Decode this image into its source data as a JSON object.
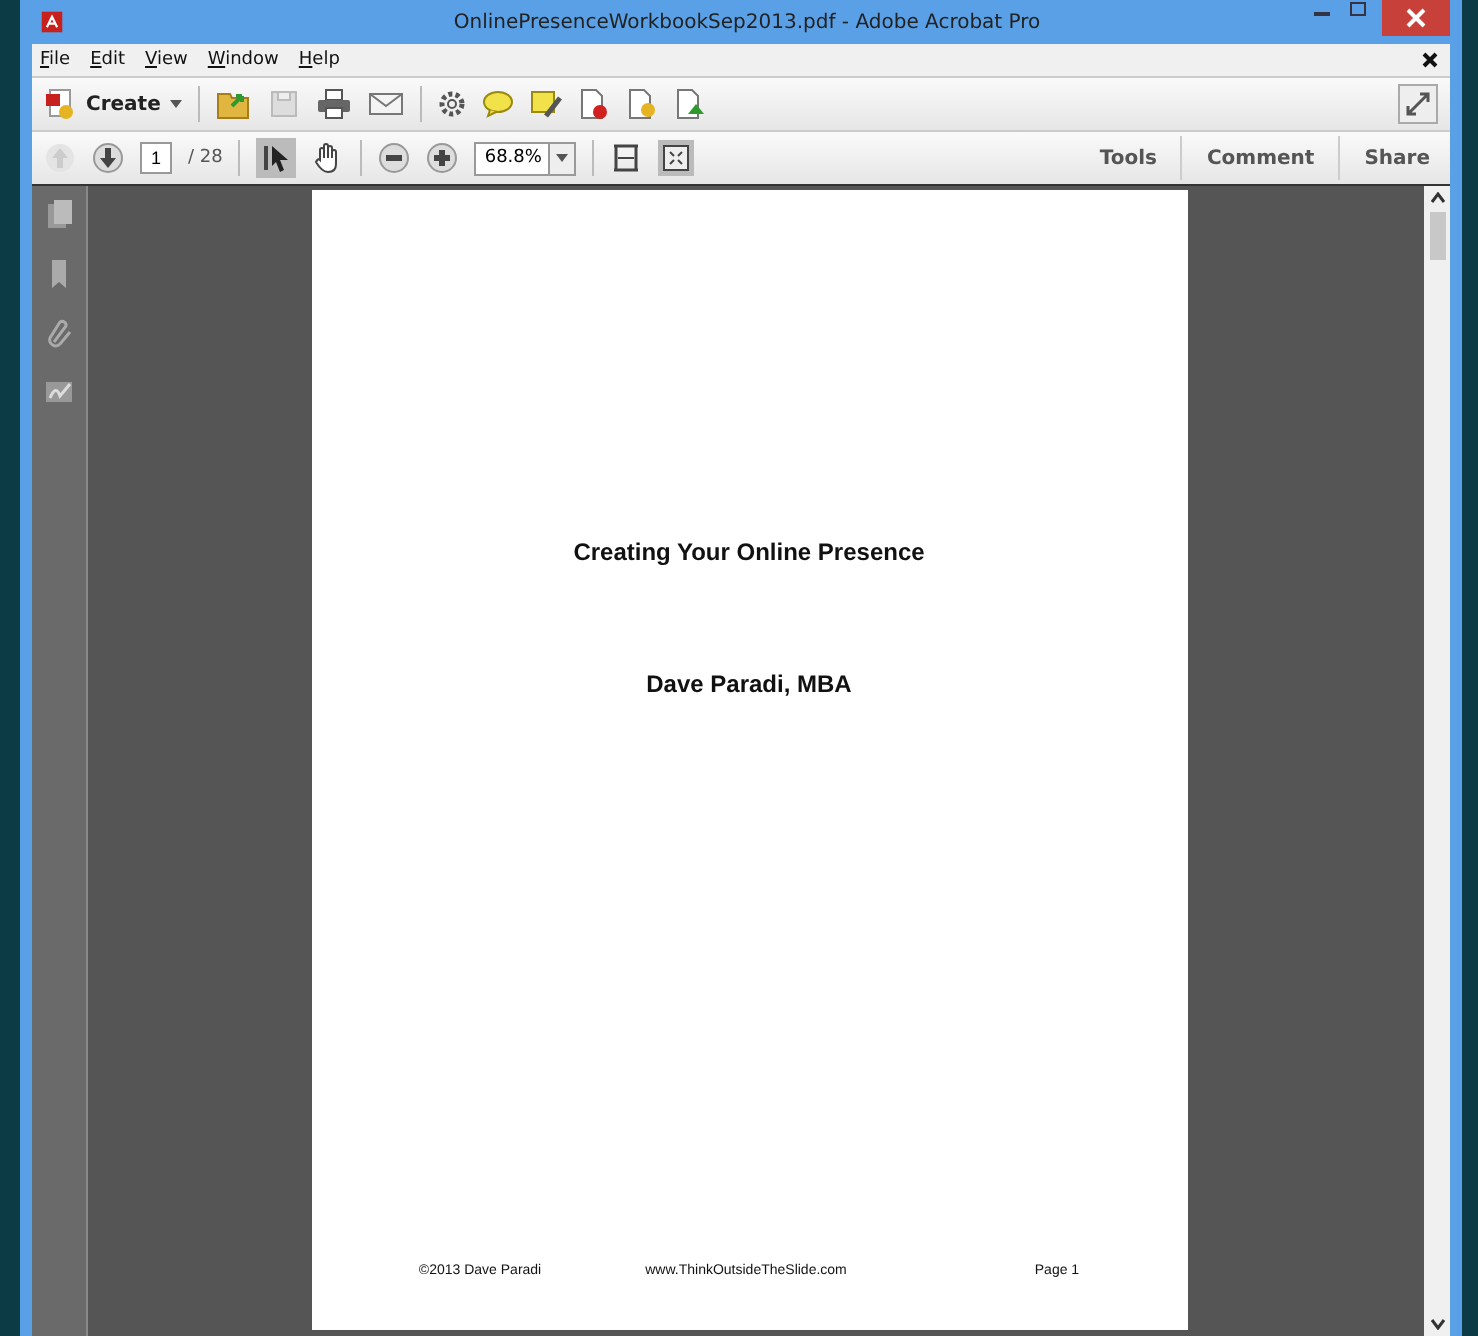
{
  "window": {
    "title": "OnlinePresenceWorkbookSep2013.pdf - Adobe Acrobat Pro"
  },
  "menu": [
    {
      "label": "File"
    },
    {
      "label": "Edit"
    },
    {
      "label": "View"
    },
    {
      "label": "Window"
    },
    {
      "label": "Help"
    }
  ],
  "toolbar": {
    "create_label": "Create"
  },
  "navigation": {
    "page_number": "1",
    "page_count": "/ 28",
    "zoom": "68.8%"
  },
  "panes": [
    {
      "label": "Tools"
    },
    {
      "label": "Comment"
    },
    {
      "label": "Share"
    }
  ],
  "document": {
    "title": "Creating Your Online Presence",
    "author": "Dave Paradi, MBA",
    "footer": [
      {
        "text": "©2013 Dave Paradi"
      },
      {
        "text": "www.ThinkOutsideTheSlide.com"
      },
      {
        "text": "Page 1"
      }
    ]
  }
}
